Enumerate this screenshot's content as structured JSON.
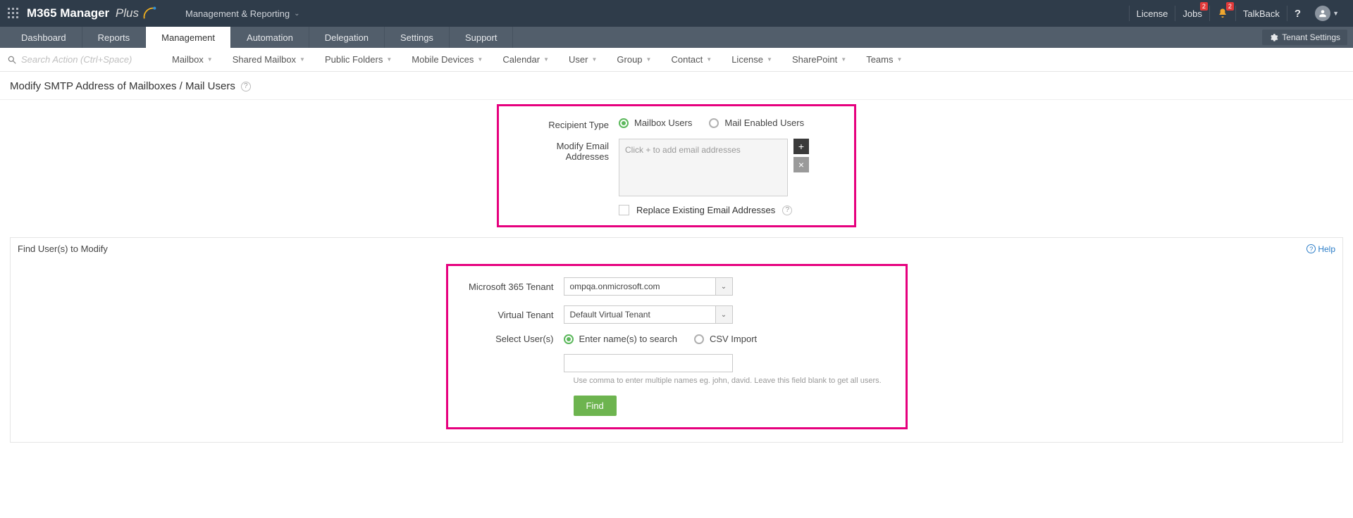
{
  "header": {
    "brand_main": "M365 Manager",
    "brand_sub": "Plus",
    "module_dropdown": "Management & Reporting",
    "links": {
      "license": "License",
      "jobs": "Jobs",
      "talkback": "TalkBack"
    },
    "jobs_badge": "2",
    "bell_badge": "2"
  },
  "nav": {
    "tabs": [
      "Dashboard",
      "Reports",
      "Management",
      "Automation",
      "Delegation",
      "Settings",
      "Support"
    ],
    "tenant_settings": "Tenant Settings"
  },
  "subbar": {
    "search_placeholder": "Search Action (Ctrl+Space)",
    "items": [
      "Mailbox",
      "Shared Mailbox",
      "Public Folders",
      "Mobile Devices",
      "Calendar",
      "User",
      "Group",
      "Contact",
      "License",
      "SharePoint",
      "Teams"
    ]
  },
  "page": {
    "title": "Modify SMTP Address of Mailboxes / Mail Users"
  },
  "form": {
    "recipient_label": "Recipient Type",
    "recipient_options": [
      "Mailbox Users",
      "Mail Enabled Users"
    ],
    "modify_label": "Modify Email Addresses",
    "textarea_placeholder": "Click + to add email addresses",
    "replace_label": "Replace Existing Email Addresses"
  },
  "panel": {
    "title": "Find User(s) to Modify",
    "help": "Help",
    "tenant_label": "Microsoft 365 Tenant",
    "tenant_value": "ompqa.onmicrosoft.com",
    "vtenant_label": "Virtual Tenant",
    "vtenant_value": "Default Virtual Tenant",
    "select_label": "Select User(s)",
    "select_options": [
      "Enter name(s) to search",
      "CSV Import"
    ],
    "hint": "Use comma to enter multiple names eg. john, david. Leave this field blank to get all users.",
    "find": "Find"
  }
}
